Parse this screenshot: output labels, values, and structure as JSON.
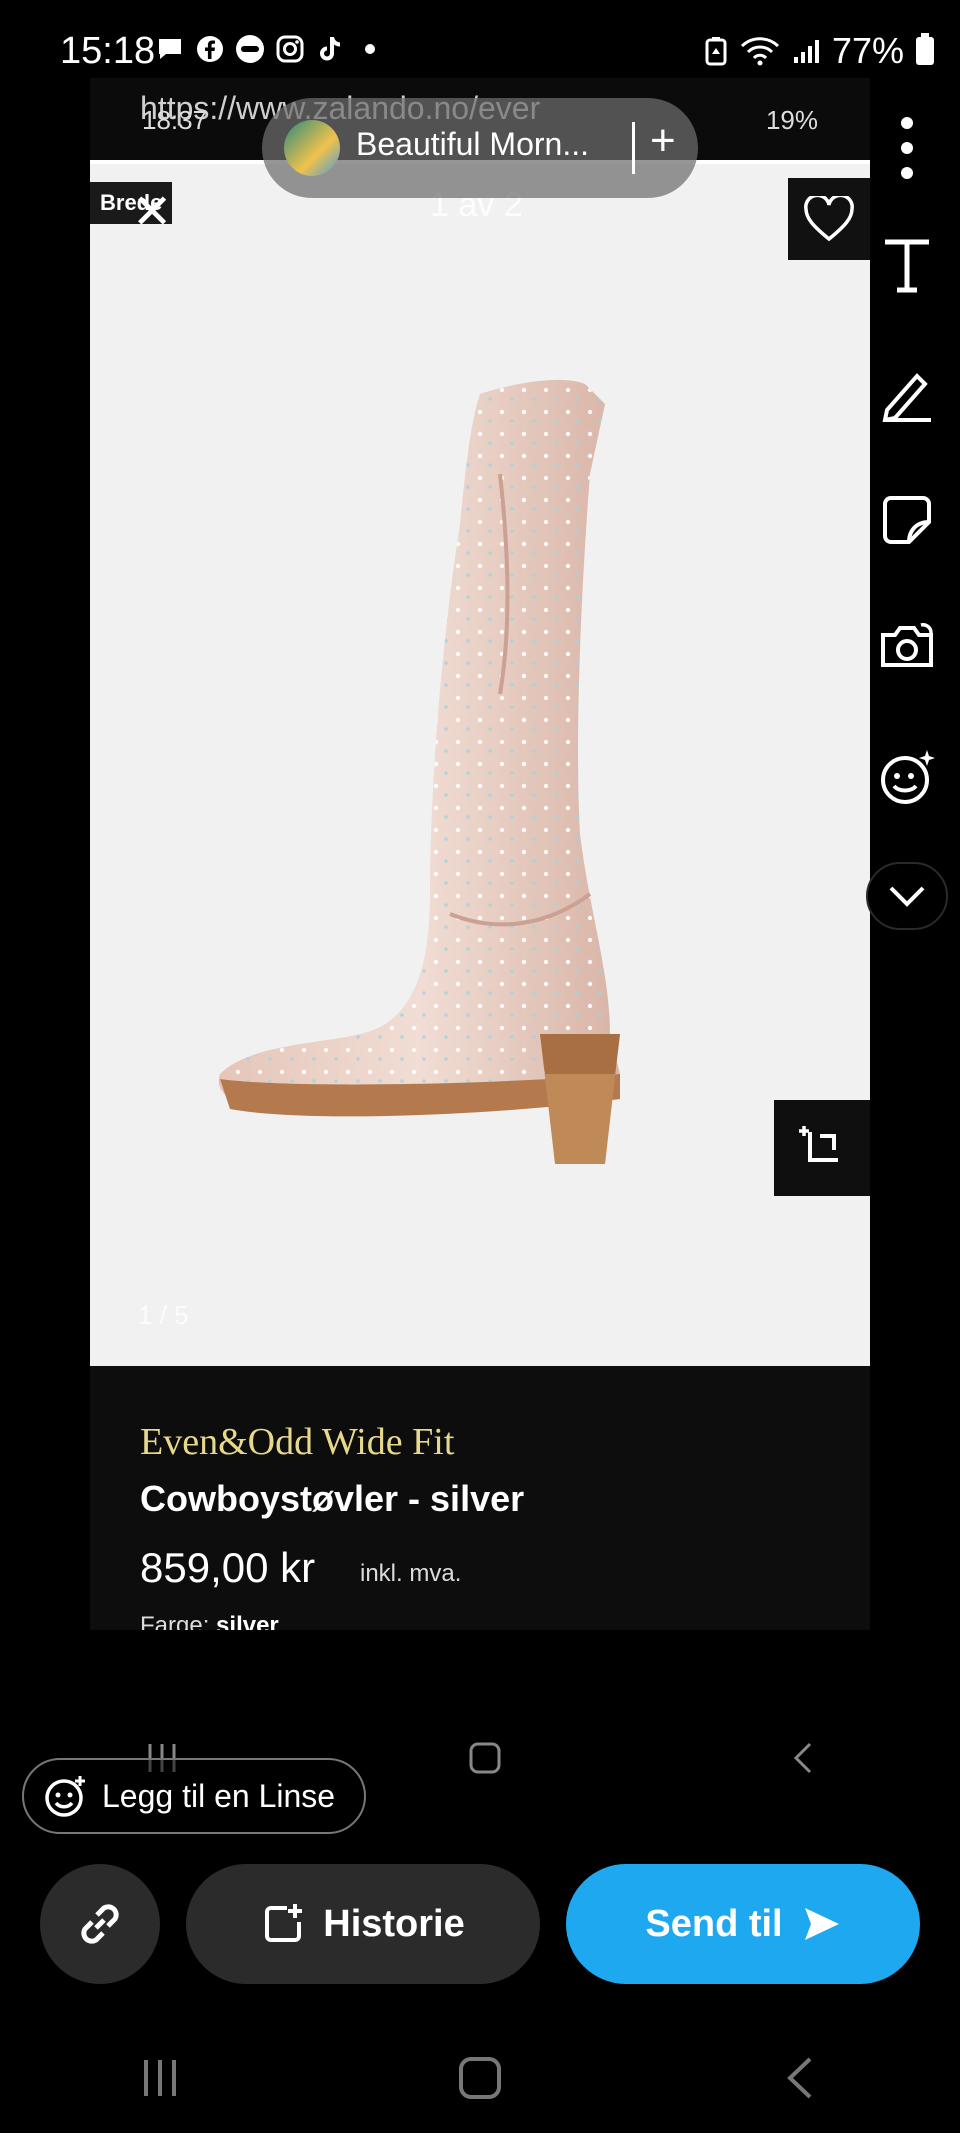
{
  "status_bar": {
    "time": "15:18",
    "battery": "77%"
  },
  "captured": {
    "url": "https://www.zalando.no/ever",
    "inner_time": "18:37",
    "inner_battery": "19%",
    "brand_tag": "Brede",
    "image_counter_top": "1 av 2",
    "image_counter_bottom": "1 / 5",
    "product": {
      "brand": "Even&Odd Wide Fit",
      "name": "Cowboystøvler - silver",
      "price": "859,00 kr",
      "price_note": "inkl. mva.",
      "color_label": "Farge:",
      "color_value": "silver"
    }
  },
  "music": {
    "title": "Beautiful Morn..."
  },
  "toolbar": {
    "items": [
      "more-icon",
      "text-icon",
      "pencil-icon",
      "sticker-icon",
      "camera-flip-icon",
      "emoji-sparkle-icon",
      "chevron-down-icon"
    ]
  },
  "lens": {
    "label": "Legg til en Linse"
  },
  "actions": {
    "story_label": "Historie",
    "send_label": "Send til"
  },
  "colors": {
    "send_button": "#1ea8f0",
    "secondary_button": "#2b2b2b",
    "brand_gold": "#e7d88c"
  }
}
